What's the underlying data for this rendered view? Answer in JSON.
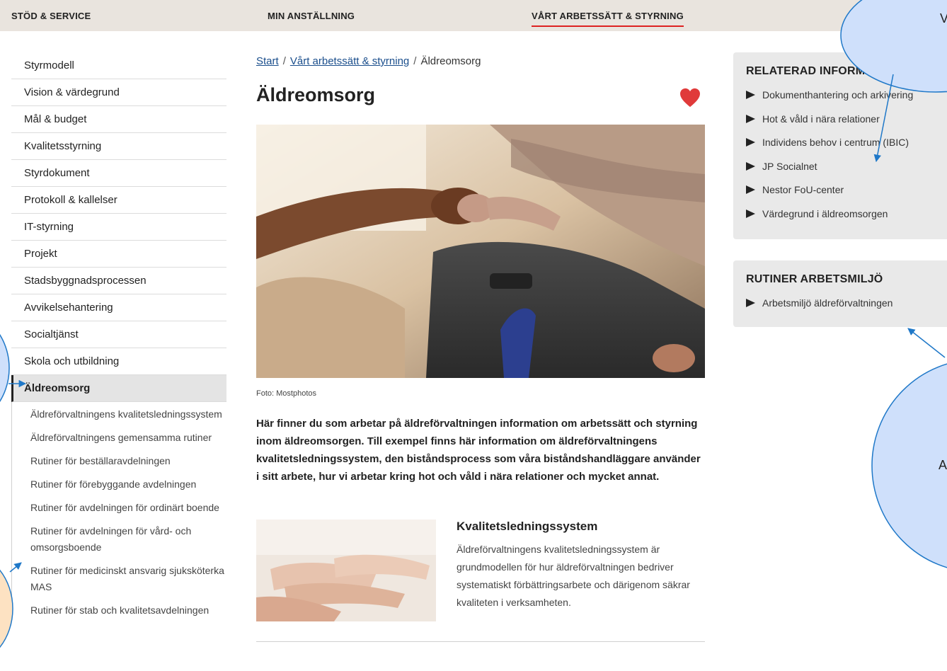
{
  "topnav": {
    "items": [
      "STÖD & SERVICE",
      "MIN ANSTÄLLNING",
      "VÅRT ARBETSSÄTT & STYRNING"
    ],
    "active_index": 2
  },
  "sidebar": {
    "items": [
      "Styrmodell",
      "Vision & värdegrund",
      "Mål & budget",
      "Kvalitetsstyrning",
      "Styrdokument",
      "Protokoll & kallelser",
      "IT-styrning",
      "Projekt",
      "Stadsbyggnadsprocessen",
      "Avvikelsehantering",
      "Socialtjänst",
      "Skola och utbildning",
      "Äldreomsorg"
    ],
    "active_label": "Äldreomsorg",
    "subitems": [
      "Äldreförvaltningens kvalitetsledningssystem",
      "Äldreförvaltningens gemensamma rutiner",
      "Rutiner för beställaravdelningen",
      "Rutiner för förebyggande avdelningen",
      "Rutiner för avdelningen för ordinärt boende",
      "Rutiner för avdelningen för vård- och omsorgsboende",
      "Rutiner för medicinskt ansvarig sjuksköterka MAS",
      "Rutiner för stab och kvalitetsavdelningen"
    ]
  },
  "breadcrumb": {
    "start": "Start",
    "sep": "/",
    "section": "Vårt arbetssätt & styrning",
    "current": "Äldreomsorg"
  },
  "main": {
    "title": "Äldreomsorg",
    "caption": "Foto: Mostphotos",
    "intro": "Här finner du som arbetar på äldreförvaltningen information om arbetssätt och styrning inom äldreomsorgen. Till exempel finns här information om äldreförvaltningens kvalitetsledningssystem, den biståndsprocess som våra biståndshandläggare använder i sitt arbete, hur vi arbetar kring hot och våld i nära relationer och mycket annat.",
    "card": {
      "title": "Kvalitetsledningssystem",
      "text": "Äldreförvaltningens kvalitetsledningssystem är grundmodellen för hur äldreförvaltningen bedriver systematiskt förbättringsarbete och därigenom säkrar kvaliteten i verksamheten."
    }
  },
  "related": {
    "title": "RELATERAD INFORMATION",
    "links": [
      "Dokumenthantering och arkivering",
      "Hot & våld i nära relationer",
      "Individens behov i centrum (IBIC)",
      "JP Socialnet",
      "Nestor FoU-center",
      "Värdegrund i äldreomsorgen"
    ]
  },
  "rutiner": {
    "title": "RUTINER ARBETSMILJÖ",
    "links": [
      "Arbetsmiljö äldreförvaltningen"
    ]
  },
  "annotations": {
    "top_right_char": "V",
    "mid_right_char": "A"
  },
  "colors": {
    "topbar_bg": "#e9e4de",
    "active_underline": "#dd2222",
    "link_blue": "#1a4e8c",
    "heart_red": "#e03a3a",
    "panel_bg": "#e9e9e9",
    "bubble_blue": "#cfe0fb",
    "bubble_orange": "#fde2c2",
    "arrow_blue": "#1f78c8"
  },
  "icons": {
    "favorite": "heart-icon",
    "list_bullet": "triangle-right-icon"
  }
}
